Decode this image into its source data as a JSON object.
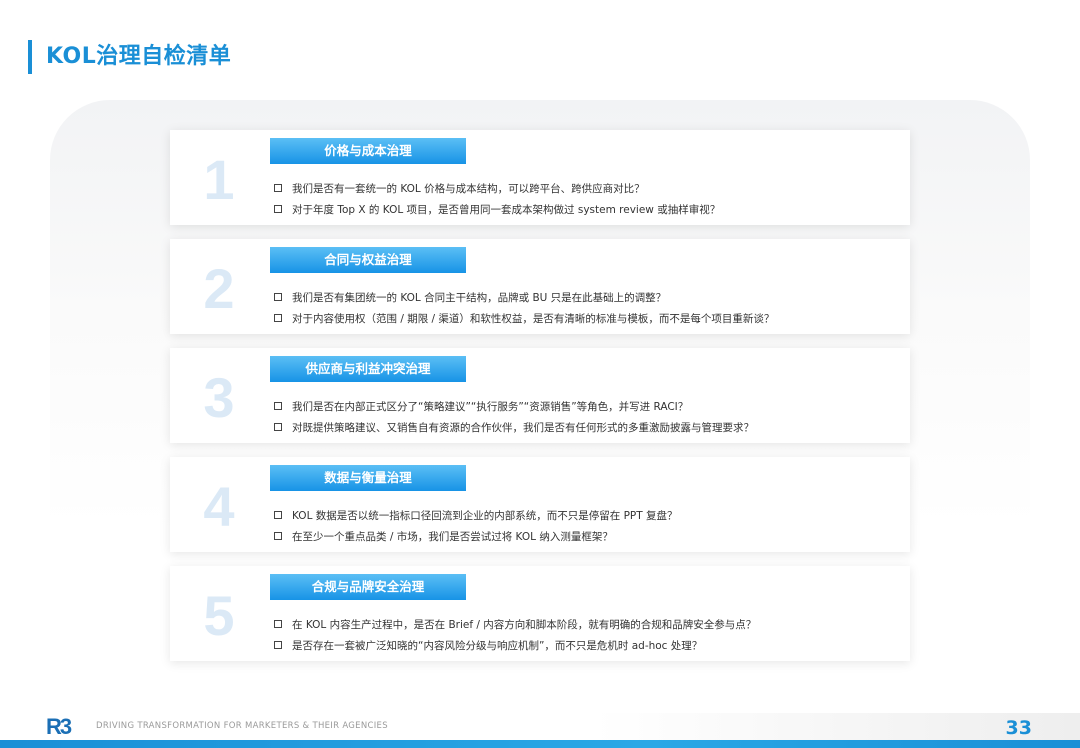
{
  "page": {
    "title": "KOL治理自检清单",
    "page_number": "33"
  },
  "footer": {
    "logo": "R3",
    "tagline": "DRIVING TRANSFORMATION FOR MARKETERS & THEIR AGENCIES"
  },
  "sections": [
    {
      "number": "1",
      "title": "价格与成本治理",
      "items": [
        "我们是否有一套统一的 KOL 价格与成本结构，可以跨平台、跨供应商对比？",
        "对于年度 Top X 的 KOL 项目，是否曾用同一套成本架构做过 system review 或抽样审视？"
      ]
    },
    {
      "number": "2",
      "title": "合同与权益治理",
      "items": [
        "我们是否有集团统一的 KOL 合同主干结构，品牌或 BU 只是在此基础上的调整？",
        "对于内容使用权（范围 / 期限 / 渠道）和软性权益，是否有清晰的标准与模板，而不是每个项目重新谈？"
      ]
    },
    {
      "number": "3",
      "title": "供应商与利益冲突治理",
      "items": [
        "我们是否在内部正式区分了“策略建议”“执行服务”“资源销售”等角色，并写进 RACI？",
        "对既提供策略建议、又销售自有资源的合作伙伴，我们是否有任何形式的多重激励披露与管理要求？"
      ]
    },
    {
      "number": "4",
      "title": "数据与衡量治理",
      "items": [
        "KOL 数据是否以统一指标口径回流到企业的内部系统，而不只是停留在 PPT 复盘？",
        "在至少一个重点品类 / 市场，我们是否尝试过将 KOL 纳入测量框架？"
      ]
    },
    {
      "number": "5",
      "title": "合规与品牌安全治理",
      "items": [
        "在 KOL 内容生产过程中，是否在 Brief / 内容方向和脚本阶段，就有明确的合规和品牌安全参与点？",
        "是否存在一套被广泛知晓的“内容风险分级与响应机制”，而不只是危机时 ad-hoc 处理？"
      ]
    }
  ]
}
